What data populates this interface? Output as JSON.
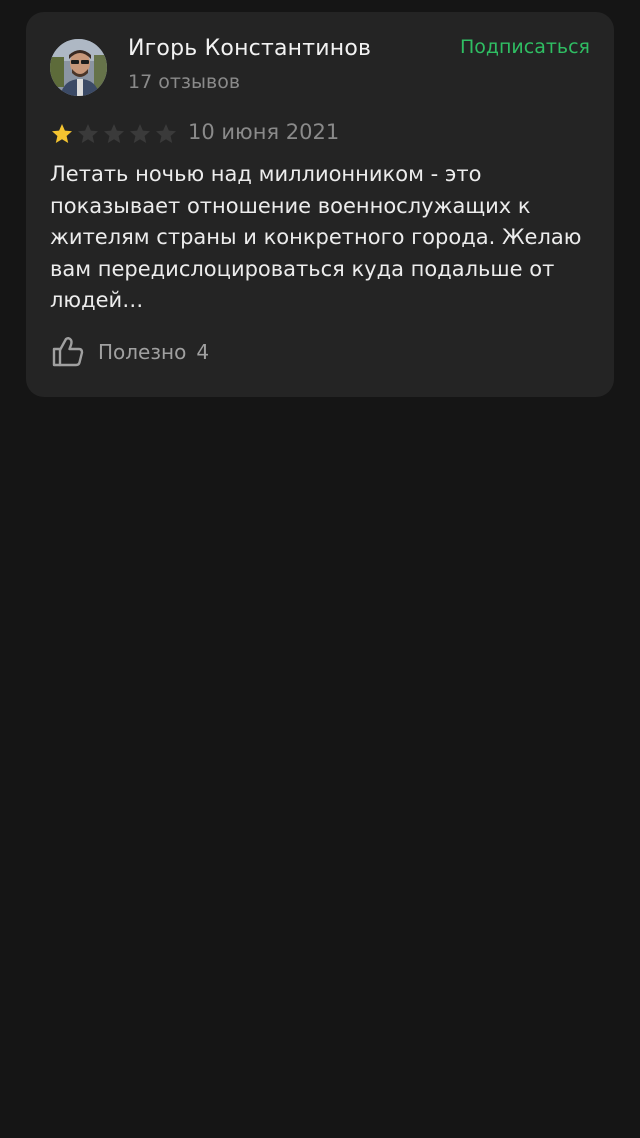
{
  "review": {
    "author": {
      "name": "Игорь Константинов",
      "reviews_count": "17 отзывов"
    },
    "subscribe_label": "Подписаться",
    "rating": 1,
    "rating_max": 5,
    "date": "10 июня 2021",
    "text": "Летать ночью над миллионником - это показывает отношение военнослужащих к жителям страны и конкретного города. Желаю вам передислоцироваться куда подальше от людей…",
    "helpful_label": "Полезно",
    "helpful_count": "4"
  },
  "colors": {
    "background": "#151515",
    "card": "#242424",
    "accent_green": "#2fbe63",
    "star_filled": "#f4c430",
    "star_empty": "#3a3a3a"
  },
  "icons": {
    "avatar": "user-avatar-photo",
    "star": "star-icon",
    "helpful": "thumbs-up-icon"
  }
}
